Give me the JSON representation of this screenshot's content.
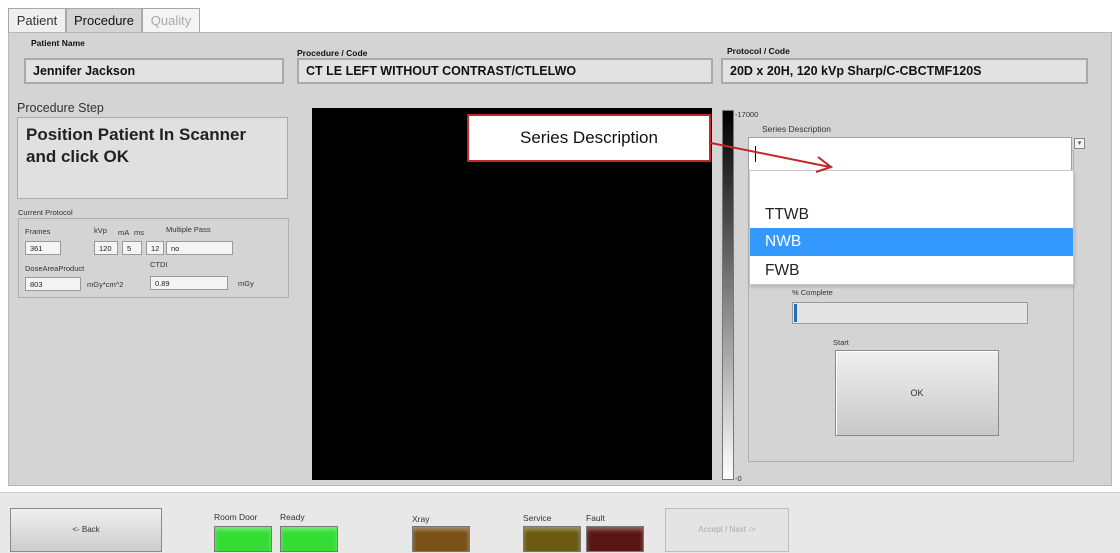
{
  "tabs": [
    {
      "label": "Patient"
    },
    {
      "label": "Procedure"
    },
    {
      "label": "Quality"
    }
  ],
  "header": {
    "patient_name_label": "Patient Name",
    "patient_name": "Jennifer Jackson",
    "procedure_label": "Procedure / Code",
    "procedure": "CT LE LEFT WITHOUT CONTRAST/CTLELWO",
    "protocol_label": "Protocol / Code",
    "protocol": "20D x 20H, 120 kVp Sharp/C-CBCTMF120S"
  },
  "procedure_step": {
    "label": "Procedure Step",
    "text_line1": "Position Patient In Scanner",
    "text_line2": "and click OK"
  },
  "current_protocol": {
    "label": "Current Protocol",
    "frames_label": "Frames",
    "frames": "361",
    "kvp_label": "kVp",
    "kvp": "120",
    "ma_label": "mA",
    "ma": "5",
    "ms_label": "ms",
    "ms": "12",
    "multipass_label": "Multiple Pass",
    "multipass": "no",
    "dap_label": "DoseAreaProduct",
    "dap": "803",
    "dap_unit": "mGy*cm^2",
    "ctdi_label": "CTDI",
    "ctdi": "0.89",
    "ctdi_unit": "mGy"
  },
  "scale": {
    "max": "17000",
    "min": "0"
  },
  "series": {
    "label": "Series Description",
    "value": "",
    "options": [
      "TTWB",
      "NWB",
      "FWB"
    ],
    "selected": "NWB"
  },
  "progress": {
    "label": "% Complete",
    "value_percent": 1
  },
  "start": {
    "label": "Start",
    "button": "OK"
  },
  "callout": {
    "text": "Series Description"
  },
  "bottom": {
    "back": "<- Back",
    "next": "Accept / Next ->",
    "indicators": [
      {
        "label": "Room Door",
        "color": "#33dd33"
      },
      {
        "label": "Ready",
        "color": "#33dd33"
      },
      {
        "label": "Xray",
        "color": "#7a5218"
      },
      {
        "label": "Service",
        "color": "#6b5a10"
      },
      {
        "label": "Fault",
        "color": "#5a1414"
      }
    ]
  },
  "colors": {
    "callout_border": "#c0282d",
    "selection": "#3399ff"
  }
}
